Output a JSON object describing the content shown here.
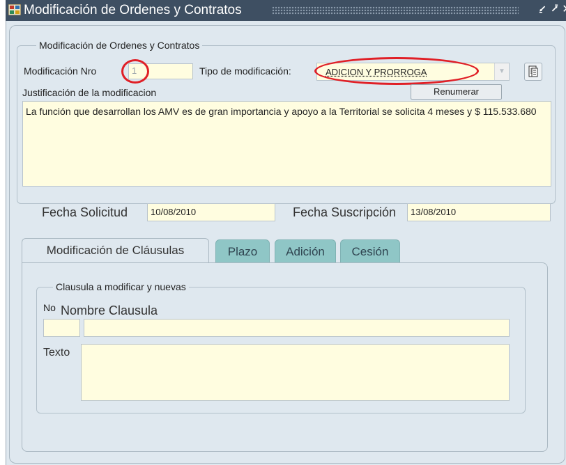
{
  "window": {
    "title": "Modificación de Ordenes y Contratos"
  },
  "form": {
    "group_title": "Modificación de Ordenes y Contratos",
    "nro_label": "Modificación Nro",
    "nro_value": "1",
    "tipo_label": "Tipo de modificación:",
    "tipo_value": "ADICION Y PRORROGA",
    "justificacion_label": "Justificación de la modificacion",
    "renumerar_label": "Renumerar",
    "justificacion_text": "La función que desarrollan los AMV es de gran importancia y apoyo  a la Territorial se solicita 4 meses y $ 115.533.680",
    "fecha_solicitud_label": "Fecha Solicitud",
    "fecha_solicitud_value": "10/08/2010",
    "fecha_suscripcion_label": "Fecha Suscripción",
    "fecha_suscripcion_value": "13/08/2010"
  },
  "tabs": [
    {
      "label": "Modificación de Cláusulas",
      "active": true
    },
    {
      "label": "Plazo",
      "active": false
    },
    {
      "label": "Adición",
      "active": false
    },
    {
      "label": "Cesión",
      "active": false
    }
  ],
  "clausula": {
    "group_title": "Clausula a modificar y nuevas",
    "no_label": "No",
    "nombre_label": "Nombre Clausula",
    "texto_label": "Texto",
    "no_value": "",
    "nombre_value": "",
    "texto_value": ""
  },
  "colors": {
    "titlebar": "#3e4f62",
    "panel": "#dfe8ef",
    "field": "#fffde0",
    "inactive_tab": "#8fc6c6",
    "highlight": "#e01f26"
  }
}
